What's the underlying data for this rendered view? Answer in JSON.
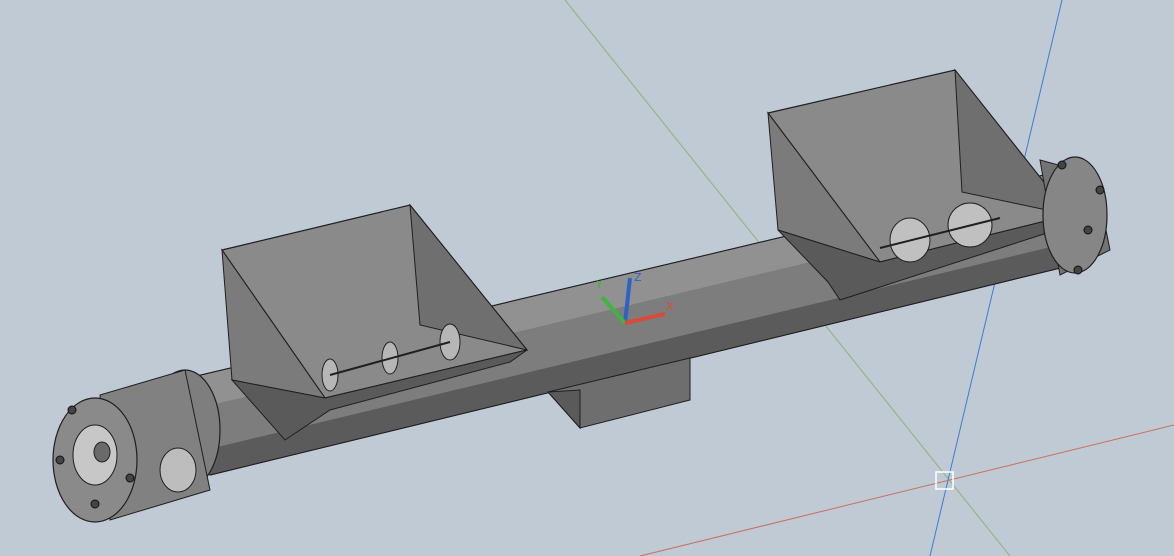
{
  "viewport": {
    "background": "#bfcad5"
  },
  "colors": {
    "body_light": "#8d8d8d",
    "body_mid": "#7a7a7a",
    "body_dark": "#5a5a5a",
    "edge": "#1f1f1f",
    "hopper_inner": "#6e6e6e",
    "hopper_outer": "#808080",
    "ucs_x": "#d84a3a",
    "ucs_y": "#3fb43f",
    "ucs_z": "#2f62c8",
    "grid_x": "#c8705e",
    "grid_y": "#8fb27a",
    "grid_z": "#3a7cd6"
  },
  "ucs": {
    "x_label": "X",
    "y_label": "Y",
    "z_label": "Z"
  },
  "cursor": {
    "icon": "pickbox-cursor-icon"
  }
}
